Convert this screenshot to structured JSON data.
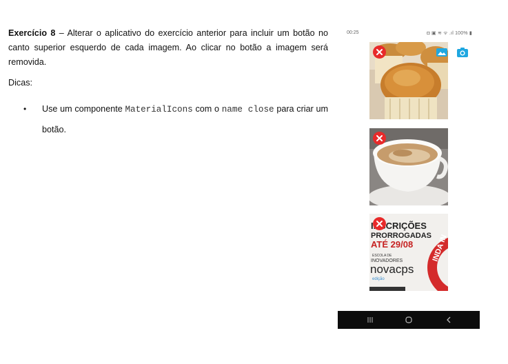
{
  "exercise": {
    "title": "Exercício 8",
    "paragraph": " – Alterar o aplicativo do exercício anterior para incluir um botão no canto superior esquerdo de cada imagem. Ao clicar no botão a imagem será removida.",
    "tips_heading": "Dicas:",
    "tip": {
      "bullet": "•",
      "part1": "Use um componente ",
      "code1": "MaterialIcons",
      "part2": " com o ",
      "code2": "name close",
      "part3": " para criar um botão."
    }
  },
  "phone": {
    "status": {
      "time": "00:25",
      "right": "◘ ▣ ≋ ᯤ .ıl 100% ▮"
    },
    "colors": {
      "close": "#e82a2a",
      "camera": "#1fa7e0",
      "navbar": "#0c0c0c"
    },
    "images": [
      {
        "name": "muffins-photo"
      },
      {
        "name": "coffee-cup-photo"
      },
      {
        "name": "poster-photo",
        "lines": [
          "INSCRIÇÕES",
          "PRORROGADAS",
          "ATÉ 29/08",
          "ESCOLA DE",
          "INOVADORES",
          "novacps",
          "edição",
          "INDA IN"
        ]
      }
    ],
    "icons": {
      "gallery": "gallery-icon",
      "camera": "camera-icon",
      "close": "close-icon",
      "recents": "recents-icon",
      "home": "home-icon",
      "back": "back-icon"
    }
  }
}
